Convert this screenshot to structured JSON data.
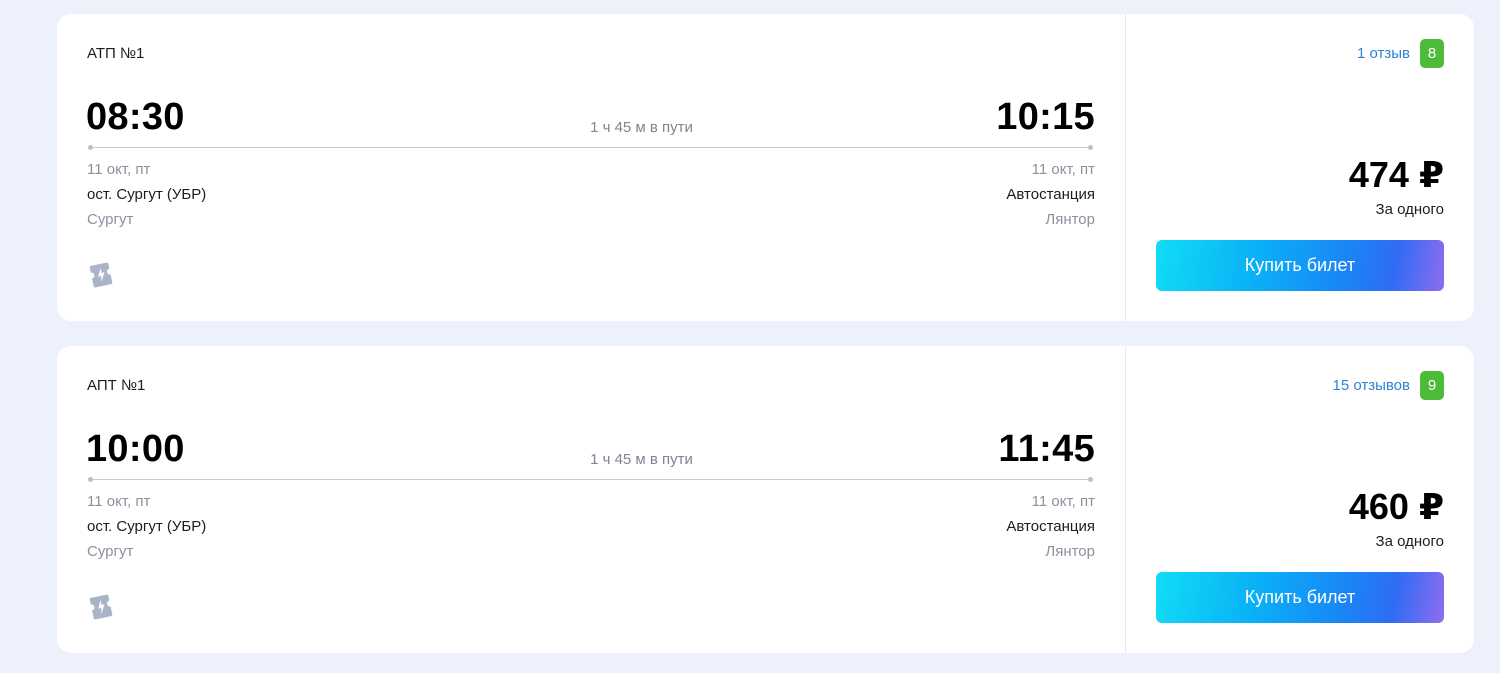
{
  "trips": [
    {
      "carrier": "АТП №1",
      "departure": {
        "time": "08:30",
        "date": "11 окт, пт",
        "stop": "ост. Сургут (УБР)",
        "city": "Сургут"
      },
      "arrival": {
        "time": "10:15",
        "date": "11 окт, пт",
        "stop": "Автостанция",
        "city": "Лянтор"
      },
      "duration": "1 ч 45 м в пути",
      "reviews": "1 отзыв",
      "score": "8",
      "price": "474 ₽",
      "price_note": "За одного",
      "buy_label": "Купить билет"
    },
    {
      "carrier": "АПТ №1",
      "departure": {
        "time": "10:00",
        "date": "11 окт, пт",
        "stop": "ост. Сургут (УБР)",
        "city": "Сургут"
      },
      "arrival": {
        "time": "11:45",
        "date": "11 окт, пт",
        "stop": "Автостанция",
        "city": "Лянтор"
      },
      "duration": "1 ч 45 м в пути",
      "reviews": "15 отзывов",
      "score": "9",
      "price": "460 ₽",
      "price_note": "За одного",
      "buy_label": "Купить билет"
    }
  ],
  "icons": {
    "ticket": "ticket-icon"
  },
  "colors": {
    "background": "#edf1fb",
    "score_badge": "#4dba3a",
    "reviews_link": "#2f83d4",
    "button_start": "#10ddf5",
    "button_end": "#8f6cf0"
  }
}
